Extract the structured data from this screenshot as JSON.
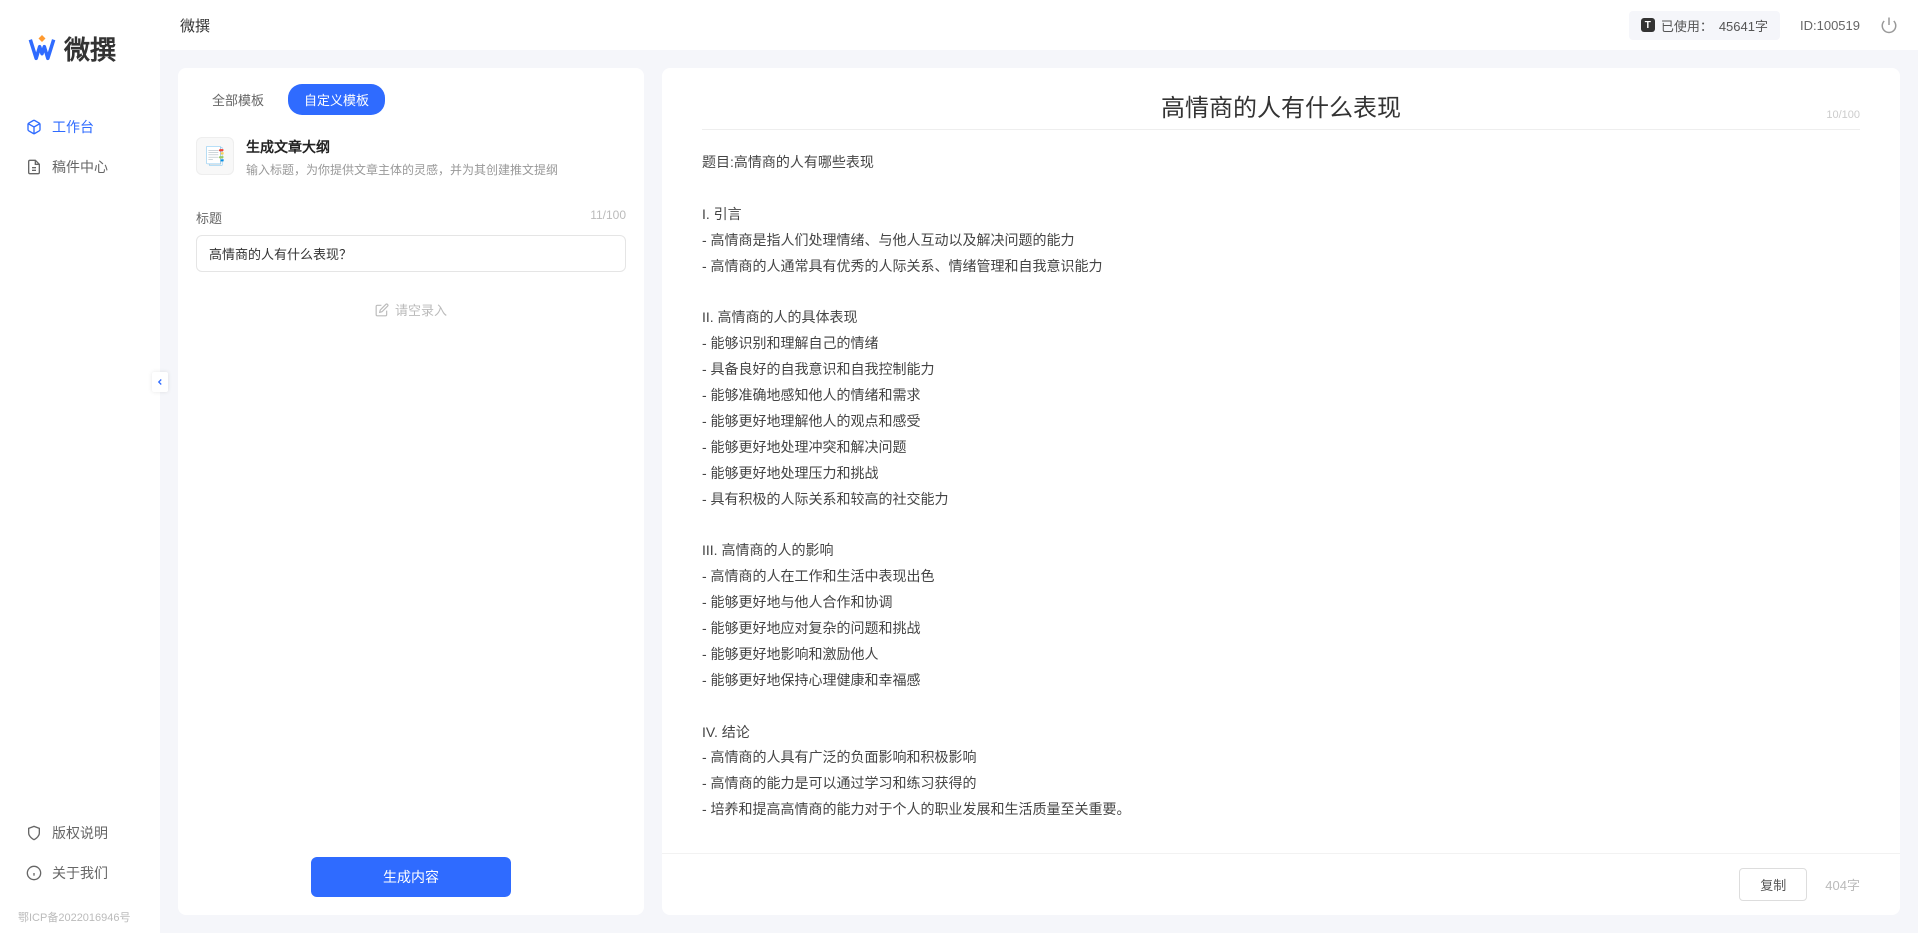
{
  "app": {
    "name": "微撰",
    "topbar_title": "微撰"
  },
  "sidebar": {
    "nav": [
      {
        "label": "工作台",
        "active": true
      },
      {
        "label": "稿件中心",
        "active": false
      }
    ],
    "bottom": [
      {
        "label": "版权说明"
      },
      {
        "label": "关于我们"
      }
    ],
    "footer": "鄂ICP备2022016946号"
  },
  "topbar": {
    "usage_label": "已使用：",
    "usage_value": "45641字",
    "user_id_label": "ID:",
    "user_id": "100519"
  },
  "left_panel": {
    "tabs": [
      {
        "label": "全部模板",
        "active": false
      },
      {
        "label": "自定义模板",
        "active": true
      }
    ],
    "template": {
      "icon": "📑",
      "title": "生成文章大纲",
      "desc": "输入标题，为你提供文章主体的灵感，并为其创建推文提纲"
    },
    "form": {
      "title_label": "标题",
      "title_counter": "11/100",
      "title_value": "高情商的人有什么表现？",
      "empty_prompt": "请空录入"
    },
    "generate_btn": "生成内容"
  },
  "output": {
    "title": "高情商的人有什么表现",
    "title_counter": "10/100",
    "body": "题目:高情商的人有哪些表现\n\nI. 引言\n- 高情商是指人们处理情绪、与他人互动以及解决问题的能力\n- 高情商的人通常具有优秀的人际关系、情绪管理和自我意识能力\n\nII. 高情商的人的具体表现\n- 能够识别和理解自己的情绪\n- 具备良好的自我意识和自我控制能力\n- 能够准确地感知他人的情绪和需求\n- 能够更好地理解他人的观点和感受\n- 能够更好地处理冲突和解决问题\n- 能够更好地处理压力和挑战\n- 具有积极的人际关系和较高的社交能力\n\nIII. 高情商的人的影响\n- 高情商的人在工作和生活中表现出色\n- 能够更好地与他人合作和协调\n- 能够更好地应对复杂的问题和挑战\n- 能够更好地影响和激励他人\n- 能够更好地保持心理健康和幸福感\n\nIV. 结论\n- 高情商的人具有广泛的负面影响和积极影响\n- 高情商的能力是可以通过学习和练习获得的\n- 培养和提高高情商的能力对于个人的职业发展和生活质量至关重要。",
    "copy_btn": "复制",
    "char_count": "404字"
  }
}
